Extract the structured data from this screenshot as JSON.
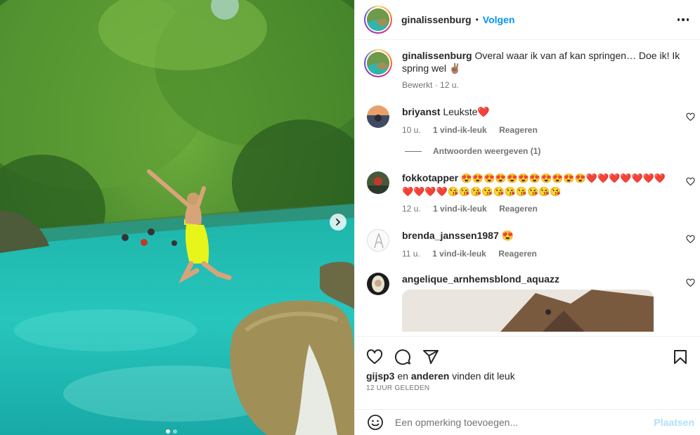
{
  "post": {
    "author": "ginalissenburg",
    "follow_label": "Volgen",
    "bullet": "•",
    "caption": "Overal waar ik van af kan springen… Doe ik! Ik spring wel ✌🏽",
    "caption_edited": "Bewerkt",
    "caption_time": "12 u."
  },
  "comments": [
    {
      "username": "briyanst",
      "text": "Leukste❤️",
      "time": "10 u.",
      "likes": "1 vind-ik-leuk",
      "reply": "Reageren",
      "view_replies": "Antwoorden weergeven (1)"
    },
    {
      "username": "fokkotapper",
      "text": "😍😍😍😍😍😍😍😍😍😍😍❤️❤️❤️❤️❤️❤️❤️❤️❤️❤️❤️😘😘😘😘😘😘😘😘😘😘",
      "time": "12 u.",
      "likes": "1 vind-ik-leuk",
      "reply": "Reageren"
    },
    {
      "username": "brenda_janssen1987",
      "text": "😍",
      "time": "11 u.",
      "likes": "1 vind-ik-leuk",
      "reply": "Reageren"
    },
    {
      "username": "angelique_arnhemsblond_aquazz",
      "text": ""
    }
  ],
  "likes_summary": {
    "first_user": "gijsp3",
    "connector": "en",
    "others": "anderen",
    "suffix": "vinden dit leuk"
  },
  "timestamp": "12 UUR GELEDEN",
  "add_comment": {
    "placeholder": "Een opmerking toevoegen...",
    "post_label": "Plaatsen"
  },
  "icons": {
    "like": "heart-icon",
    "comment": "comment-icon",
    "share": "share-icon",
    "save": "bookmark-icon",
    "emoji": "emoji-icon",
    "next": "chevron-right-icon",
    "more": "more-icon"
  },
  "colors": {
    "link_blue": "#0095f6",
    "post_disabled": "#b2dffc",
    "secondary_text": "#737373"
  }
}
